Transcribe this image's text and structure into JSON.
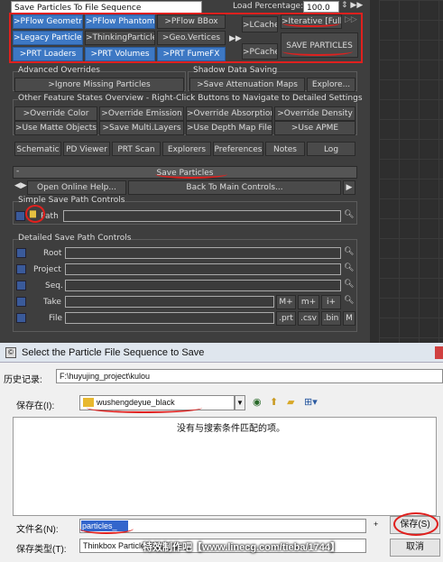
{
  "top": {
    "dropdown": "Save Particles To File Sequence",
    "load_pct_label": "Load Percentage:",
    "load_pct_value": "100.0"
  },
  "src": {
    "pflow_geometry": ">PFlow Geometry",
    "pflow_phantom": ">PFlow Phantom",
    "pflow_bbox": ">PFlow BBox",
    "legacy": ">Legacy Particles",
    "thinking": ">ThinkingParticles",
    "geo_vert": ">Geo.Vertices",
    "prt_loaders": ">PRT Loaders",
    "prt_volumes": ">PRT Volumes",
    "prt_fumefx": ">PRT FumeFX",
    "lcache": ">LCache",
    "pcache": ">PCache",
    "iterative": ">Iterative [Full]",
    "save_particles": "SAVE PARTICLES"
  },
  "adv": {
    "title": "Advanced Overrides",
    "ignore": ">Ignore Missing Particles"
  },
  "shadow": {
    "title": "Shadow Data Saving",
    "atten": ">Save Attenuation Maps",
    "explore": "Explore..."
  },
  "other": {
    "title": "Other Feature States Overview - Right-Click Buttons to Navigate to Detailed Settings",
    "b1": ">Override Color",
    "b2": ">Override Emission",
    "b3": ">Override Absorption",
    "b4": ">Override Density",
    "b5": ">Use Matte Objects",
    "b6": ">Save Multi.Layers",
    "b7": ">Use Depth Map Files",
    "b8": ">Use APME"
  },
  "tabs": {
    "t1": "Schematic",
    "t2": "PD Viewer",
    "t3": "PRT Scan",
    "t4": "Explorers",
    "t5": "Preferences",
    "t6": "Notes",
    "t7": "Log"
  },
  "rollout": {
    "minus": "-",
    "title": "Save Particles",
    "online": "Open Online Help...",
    "back": "Back To Main Controls..."
  },
  "simple": {
    "title": "Simple Save Path Controls",
    "path": "Path"
  },
  "detailed": {
    "title": "Detailed Save Path Controls",
    "root": "Root",
    "project": "Project",
    "seq": "Seq.",
    "take": "Take",
    "file": "File",
    "mplus": "M+",
    "mminus": "m+",
    "iplus": "i+",
    "prt": ".prt",
    "csv": ".csv",
    "bin": ".bin",
    "m": "M"
  },
  "dialog": {
    "title": "Select the Particle File Sequence to Save",
    "history_label": "历史记录:",
    "history_value": "F:\\huyujing_project\\kulou",
    "savein_label": "保存在(I):",
    "savein_value": "wushengdeyue_black",
    "empty_msg": "没有与搜索条件匹配的项。",
    "filename_label": "文件名(N):",
    "filename_value": "particles_",
    "filetype_label": "保存类型(T):",
    "filetype_value": "Thinkbox Particle Files (*.prt)",
    "save_btn": "保存(S)",
    "cancel_btn": "取消",
    "watermark": "特效制作吧【www.linecg.com/tieba/1744】"
  }
}
